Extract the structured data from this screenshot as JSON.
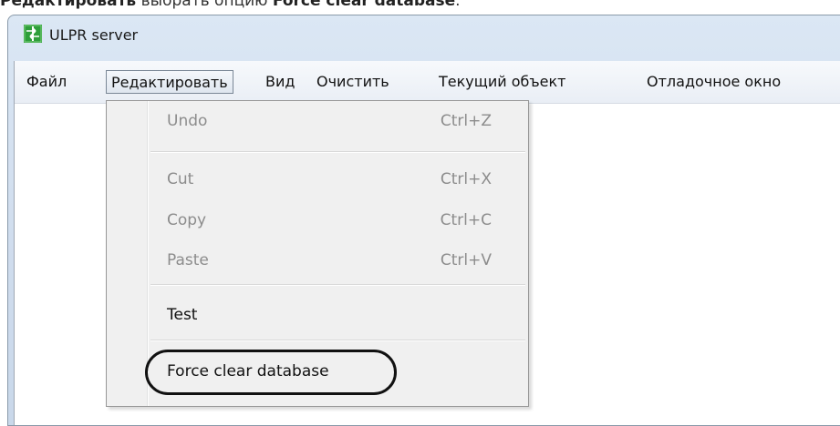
{
  "caption": {
    "prefix_bold": "Редактировать",
    "middle": " выбрать опцию ",
    "option_bold": "Force clear database",
    "suffix": "."
  },
  "window": {
    "title": "ULPR server",
    "icon": "ulpr-app-icon"
  },
  "menubar": {
    "items": [
      "Файл",
      "Редактировать",
      "Вид",
      "Очистить",
      "Текущий объект",
      "Отладочное окно"
    ]
  },
  "edit_menu": {
    "undo": {
      "label": "Undo",
      "shortcut": "Ctrl+Z"
    },
    "cut": {
      "label": "Cut",
      "shortcut": "Ctrl+X"
    },
    "copy": {
      "label": "Copy",
      "shortcut": "Ctrl+C"
    },
    "paste": {
      "label": "Paste",
      "shortcut": "Ctrl+V"
    },
    "test": {
      "label": "Test"
    },
    "force_clear": {
      "label": "Force clear database"
    }
  },
  "colors": {
    "disabled_text": "#8c8c8c",
    "icon_green": "#2e9e3a"
  }
}
